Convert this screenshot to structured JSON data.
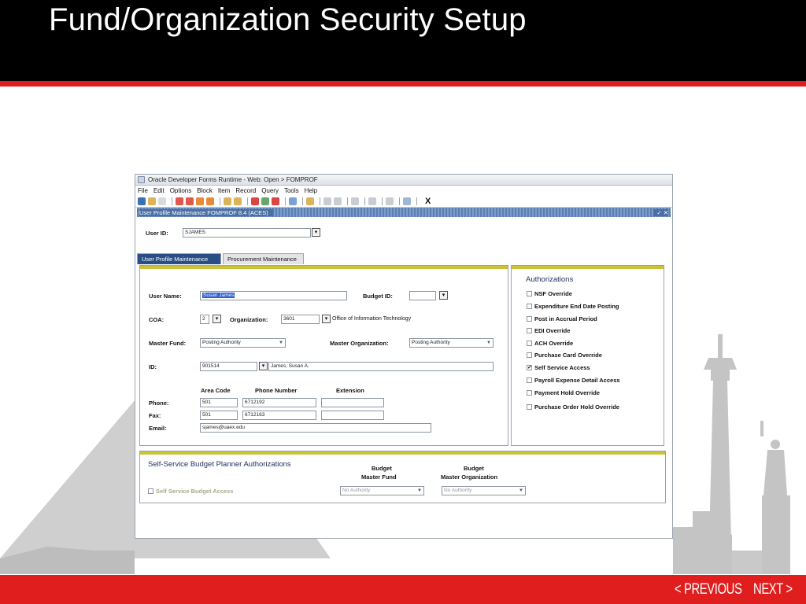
{
  "slide": {
    "title": "Fund/Organization Security Setup",
    "nav": {
      "previous": "< PREVIOUS",
      "next": "NEXT >"
    },
    "colors": {
      "header": "#000000",
      "accent": "#e01e1e"
    }
  },
  "app": {
    "window_title": "Oracle Developer Forms Runtime - Web: Open > FOMPROF",
    "menu": [
      "File",
      "Edit",
      "Options",
      "Block",
      "Item",
      "Record",
      "Query",
      "Tools",
      "Help"
    ],
    "toolbar_close": "X",
    "form_title": "User Profile Maintenance  FOMPROF  8.4  (ACES)",
    "form_title_controls": "✓ ✕",
    "user_id": {
      "label": "User ID:",
      "value": "SJAMES"
    },
    "tabs": [
      "User Profile Maintenance",
      "Procurement Maintenance"
    ],
    "main": {
      "user_name": {
        "label": "User Name:",
        "value": "Susan James"
      },
      "budget_id": {
        "label": "Budget ID:",
        "value": ""
      },
      "coa": {
        "label": "COA:",
        "value": "2"
      },
      "organization": {
        "label": "Organization:",
        "value": "3601",
        "description": "Office of Information Technology"
      },
      "master_fund": {
        "label": "Master Fund:",
        "value": "Posting Authority"
      },
      "master_org": {
        "label": "Master Organization:",
        "value": "Posting Authority"
      },
      "id": {
        "label": "ID:",
        "value": "901514",
        "name": "James, Susan A."
      },
      "headers": {
        "area_code": "Area Code",
        "phone_number": "Phone Number",
        "extension": "Extension"
      },
      "phone": {
        "label": "Phone:",
        "area": "501",
        "number": "6712192",
        "ext": ""
      },
      "fax": {
        "label": "Fax:",
        "area": "501",
        "number": "6712163",
        "ext": ""
      },
      "email": {
        "label": "Email:",
        "value": "sjames@uaex.edu"
      }
    },
    "authorizations": {
      "title": "Authorizations",
      "items": [
        {
          "label": "NSF Override",
          "checked": false
        },
        {
          "label": "Expenditure End Date Posting",
          "checked": false
        },
        {
          "label": "Post in Accrual Period",
          "checked": false
        },
        {
          "label": "EDI Override",
          "checked": false
        },
        {
          "label": "ACH Override",
          "checked": false
        },
        {
          "label": "Purchase Card Override",
          "checked": false
        },
        {
          "label": "Self Service Access",
          "checked": true
        },
        {
          "label": "Payroll Expense Detail Access",
          "checked": false
        },
        {
          "label": "Payment Hold Override",
          "checked": false
        },
        {
          "label": "Purchase Order Hold Override",
          "checked": false
        }
      ]
    },
    "budget_planner": {
      "title": "Self-Service Budget Planner Authorizations",
      "col1_line1": "Budget",
      "col1_line2": "Master Fund",
      "col2_line1": "Budget",
      "col2_line2": "Master Organization",
      "access_label": "Self Service Budget Access",
      "master_fund_value": "No Authority",
      "master_org_value": "No Authority"
    }
  }
}
